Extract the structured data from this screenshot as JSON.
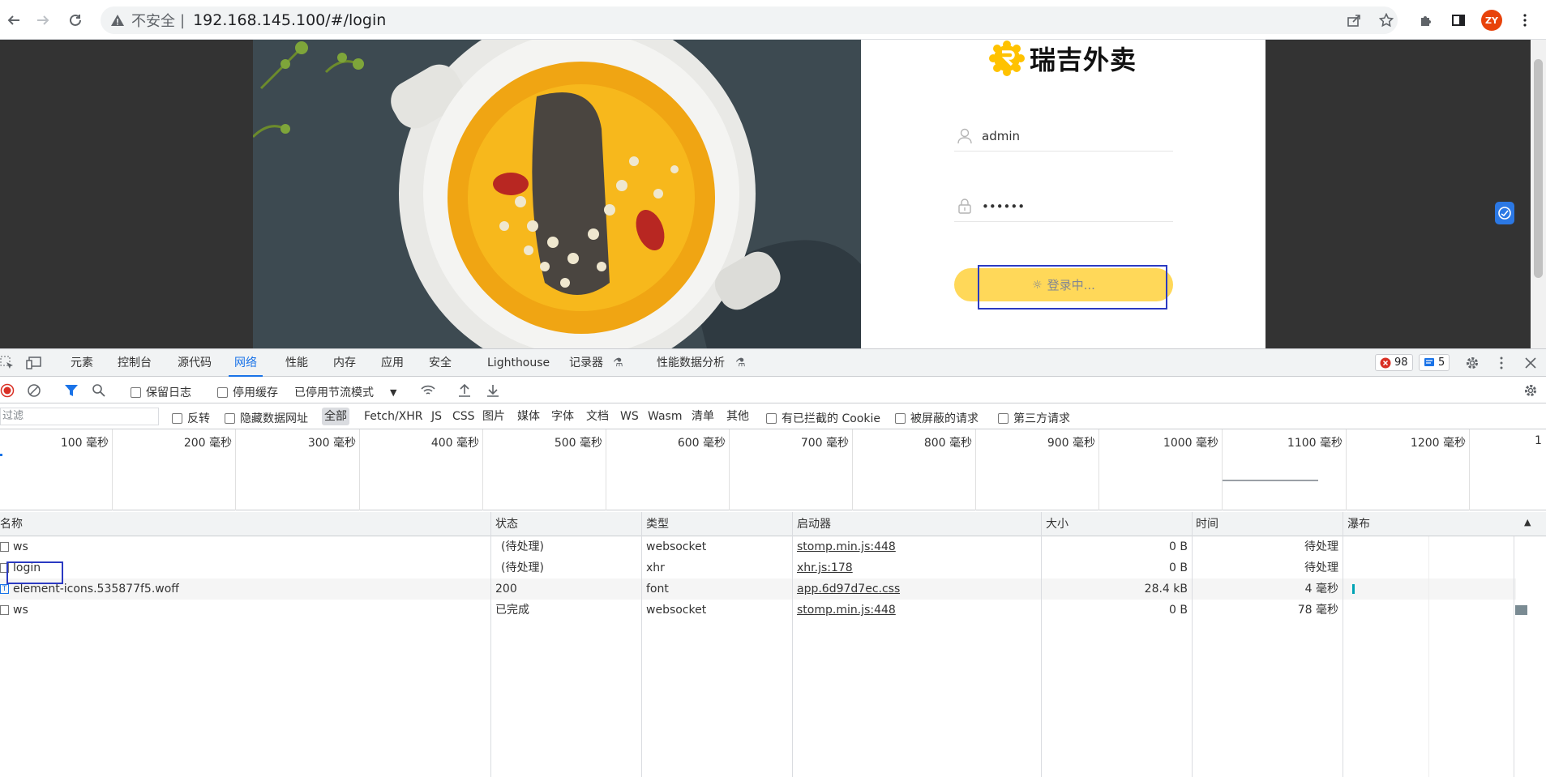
{
  "browser": {
    "insecure_label": "不安全",
    "separator": "|",
    "url": "192.168.145.100/#/login",
    "profile_initials": "ZY"
  },
  "page": {
    "brand_name": "瑞吉外卖",
    "username_value": "admin",
    "password_mask": "••••••",
    "login_button_label": "登录中..."
  },
  "devtools": {
    "tabs": [
      "元素",
      "控制台",
      "源代码",
      "网络",
      "性能",
      "内存",
      "应用",
      "安全",
      "Lighthouse",
      "记录器",
      "性能数据分析"
    ],
    "active_tab": "网络",
    "error_count": "98",
    "message_count": "5",
    "toolbar": {
      "preserve_log": "保留日志",
      "disable_cache": "停用缓存",
      "throttling": "已停用节流模式"
    },
    "filter": {
      "placeholder": "过滤",
      "invert": "反转",
      "hide_data_urls": "隐藏数据网址",
      "types": [
        "全部",
        "Fetch/XHR",
        "JS",
        "CSS",
        "图片",
        "媒体",
        "字体",
        "文档",
        "WS",
        "Wasm",
        "清单",
        "其他"
      ],
      "selected_type": "全部",
      "blocked_cookies": "有已拦截的 Cookie",
      "blocked_requests": "被屏蔽的请求",
      "third_party": "第三方请求"
    },
    "timeline_ticks": [
      "100 毫秒",
      "200 毫秒",
      "300 毫秒",
      "400 毫秒",
      "500 毫秒",
      "600 毫秒",
      "700 毫秒",
      "800 毫秒",
      "900 毫秒",
      "1000 毫秒",
      "1100 毫秒",
      "1200 毫秒",
      "1"
    ],
    "columns": [
      "名称",
      "状态",
      "类型",
      "启动器",
      "大小",
      "时间",
      "瀑布"
    ],
    "rows": [
      {
        "name": "ws",
        "status": "(待处理)",
        "type": "websocket",
        "initiator": "stomp.min.js:448",
        "size": "0 B",
        "time": "待处理"
      },
      {
        "name": "login",
        "status": "(待处理)",
        "type": "xhr",
        "initiator": "xhr.js:178",
        "size": "0 B",
        "time": "待处理"
      },
      {
        "name": "element-icons.535877f5.woff",
        "status": "200",
        "type": "font",
        "initiator": "app.6d97d7ec.css",
        "size": "28.4 kB",
        "time": "4 毫秒"
      },
      {
        "name": "ws",
        "status": "已完成",
        "type": "websocket",
        "initiator": "stomp.min.js:448",
        "size": "0 B",
        "time": "78 毫秒"
      }
    ]
  },
  "colors": {
    "accent": "#1a73e8",
    "login_button": "#ffd859",
    "highlight_box": "#2b3ac2",
    "error_red": "#d93025"
  }
}
